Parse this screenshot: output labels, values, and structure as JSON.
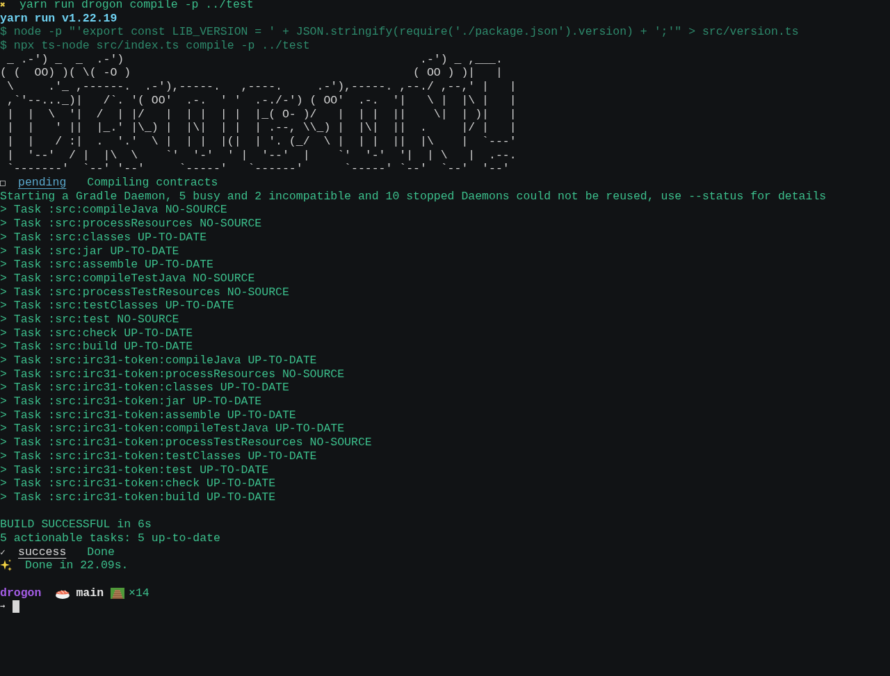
{
  "command": {
    "icon": "✖",
    "text": "yarn run drogon compile -p ../test"
  },
  "yarn_version": "yarn run v1.22.19",
  "script_lines": [
    "$ node -p \"'export const LIB_VERSION = ' + JSON.stringify(require('./package.json').version) + ';'\" > src/version.ts",
    "$ npx ts-node src/index.ts compile -p ../test"
  ],
  "banner": [
    " _ .-') _  _  .-')                                           .-') _ ,___.",
    "( (  OO) )( \\( -O )                                         ( OO ) )|   |",
    " \\     .'_ ,------.  .-'),-----.   ,----.     .-'),-----. ,--./ ,--,' |   |",
    " ,`'--..._)|   /`. '( OO'  .-.  ' '  .-./-') ( OO'  .-.  '|   \\ |  |\\ |   |",
    " |  |  \\  '|  /  | |/   |  | |  | |  |_( O- )/   |  | |  ||    \\|  | )|   |",
    " |  |   ' ||  |_.' |\\_) |  |\\|  | |  | .--, \\\\_) |  |\\|  ||  .     |/ |   |",
    " |  |   / :|  .  '.'  \\ |  | |  |(|  | '. (_/  \\ |  | |  ||  |\\    |  `---'",
    " |  '--'  / |  |\\  \\    `'  '-'  ' |  '--'  |    `'  '-'  '|  | \\   |  .--.",
    " `-------'  `--' '--'     `-----'   `------'      `-----' `--'  `--'  '--'"
  ],
  "pending": {
    "icon": "□",
    "label": "pending",
    "message": "Compiling contracts"
  },
  "gradle_output": [
    "Starting a Gradle Daemon, 5 busy and 2 incompatible and 10 stopped Daemons could not be reused, use --status for details",
    "> Task :src:compileJava NO-SOURCE",
    "> Task :src:processResources NO-SOURCE",
    "> Task :src:classes UP-TO-DATE",
    "> Task :src:jar UP-TO-DATE",
    "> Task :src:assemble UP-TO-DATE",
    "> Task :src:compileTestJava NO-SOURCE",
    "> Task :src:processTestResources NO-SOURCE",
    "> Task :src:testClasses UP-TO-DATE",
    "> Task :src:test NO-SOURCE",
    "> Task :src:check UP-TO-DATE",
    "> Task :src:build UP-TO-DATE",
    "> Task :src:irc31-token:compileJava UP-TO-DATE",
    "> Task :src:irc31-token:processResources NO-SOURCE",
    "> Task :src:irc31-token:classes UP-TO-DATE",
    "> Task :src:irc31-token:jar UP-TO-DATE",
    "> Task :src:irc31-token:assemble UP-TO-DATE",
    "> Task :src:irc31-token:compileTestJava UP-TO-DATE",
    "> Task :src:irc31-token:processTestResources NO-SOURCE",
    "> Task :src:irc31-token:testClasses UP-TO-DATE",
    "> Task :src:irc31-token:test UP-TO-DATE",
    "> Task :src:irc31-token:check UP-TO-DATE",
    "> Task :src:irc31-token:build UP-TO-DATE"
  ],
  "build_summary": [
    "BUILD SUCCESSFUL in 6s",
    "5 actionable tasks: 5 up-to-date"
  ],
  "success": {
    "icon": "✓",
    "label": "success",
    "message": "Done"
  },
  "done": {
    "text": "Done in 22.09s."
  },
  "prompt": {
    "directory": "drogon",
    "branch": "main",
    "count": "×14",
    "symbol": "→"
  }
}
